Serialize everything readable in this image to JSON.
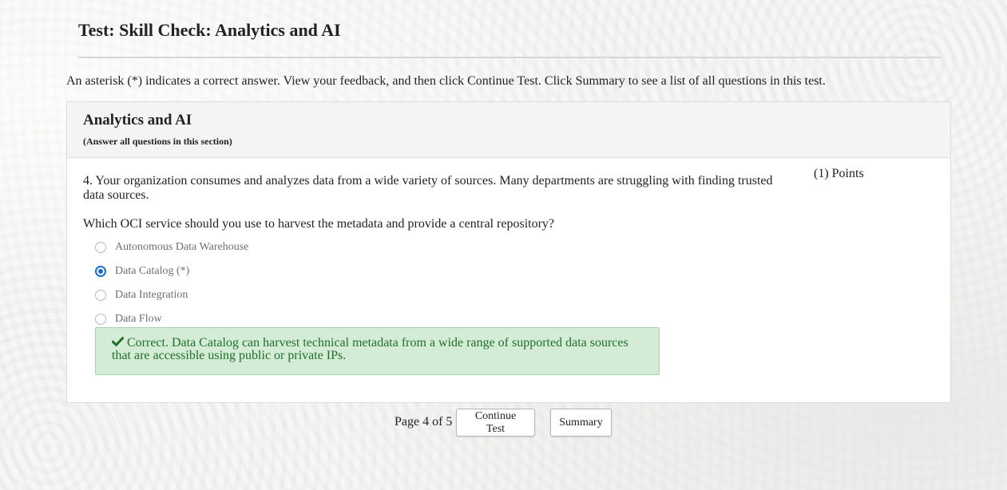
{
  "page": {
    "title": "Test: Skill Check: Analytics and AI",
    "instructions": "An asterisk (*) indicates a correct answer. View your feedback, and then click Continue Test. Click Summary to see a list of all questions in this test."
  },
  "section": {
    "title": "Analytics and AI",
    "subtitle": "(Answer all questions in this section)"
  },
  "question": {
    "text": "4. Your organization consumes and analyzes data from a wide variety of sources. Many departments are struggling with finding trusted data sources.",
    "points": "(1) Points",
    "prompt": "Which OCI service should you use to harvest the metadata and provide a central repository?",
    "options": [
      {
        "label": "Autonomous Data Warehouse",
        "selected": false
      },
      {
        "label": "Data Catalog (*)",
        "selected": true
      },
      {
        "label": "Data Integration",
        "selected": false
      },
      {
        "label": "Data Flow",
        "selected": false
      }
    ],
    "feedback": {
      "icon": "check-icon",
      "text": "Correct. Data Catalog can harvest technical metadata from a wide range of supported data sources that are accessible using public or private IPs.",
      "color": "#1e6f2a",
      "background": "#d4ecd6"
    }
  },
  "footer": {
    "pagination": "Page 4 of 5",
    "continue_label": "Continue Test",
    "summary_label": "Summary"
  },
  "colors": {
    "accent": "#1a6dcc",
    "background": "#f6f6f5"
  }
}
